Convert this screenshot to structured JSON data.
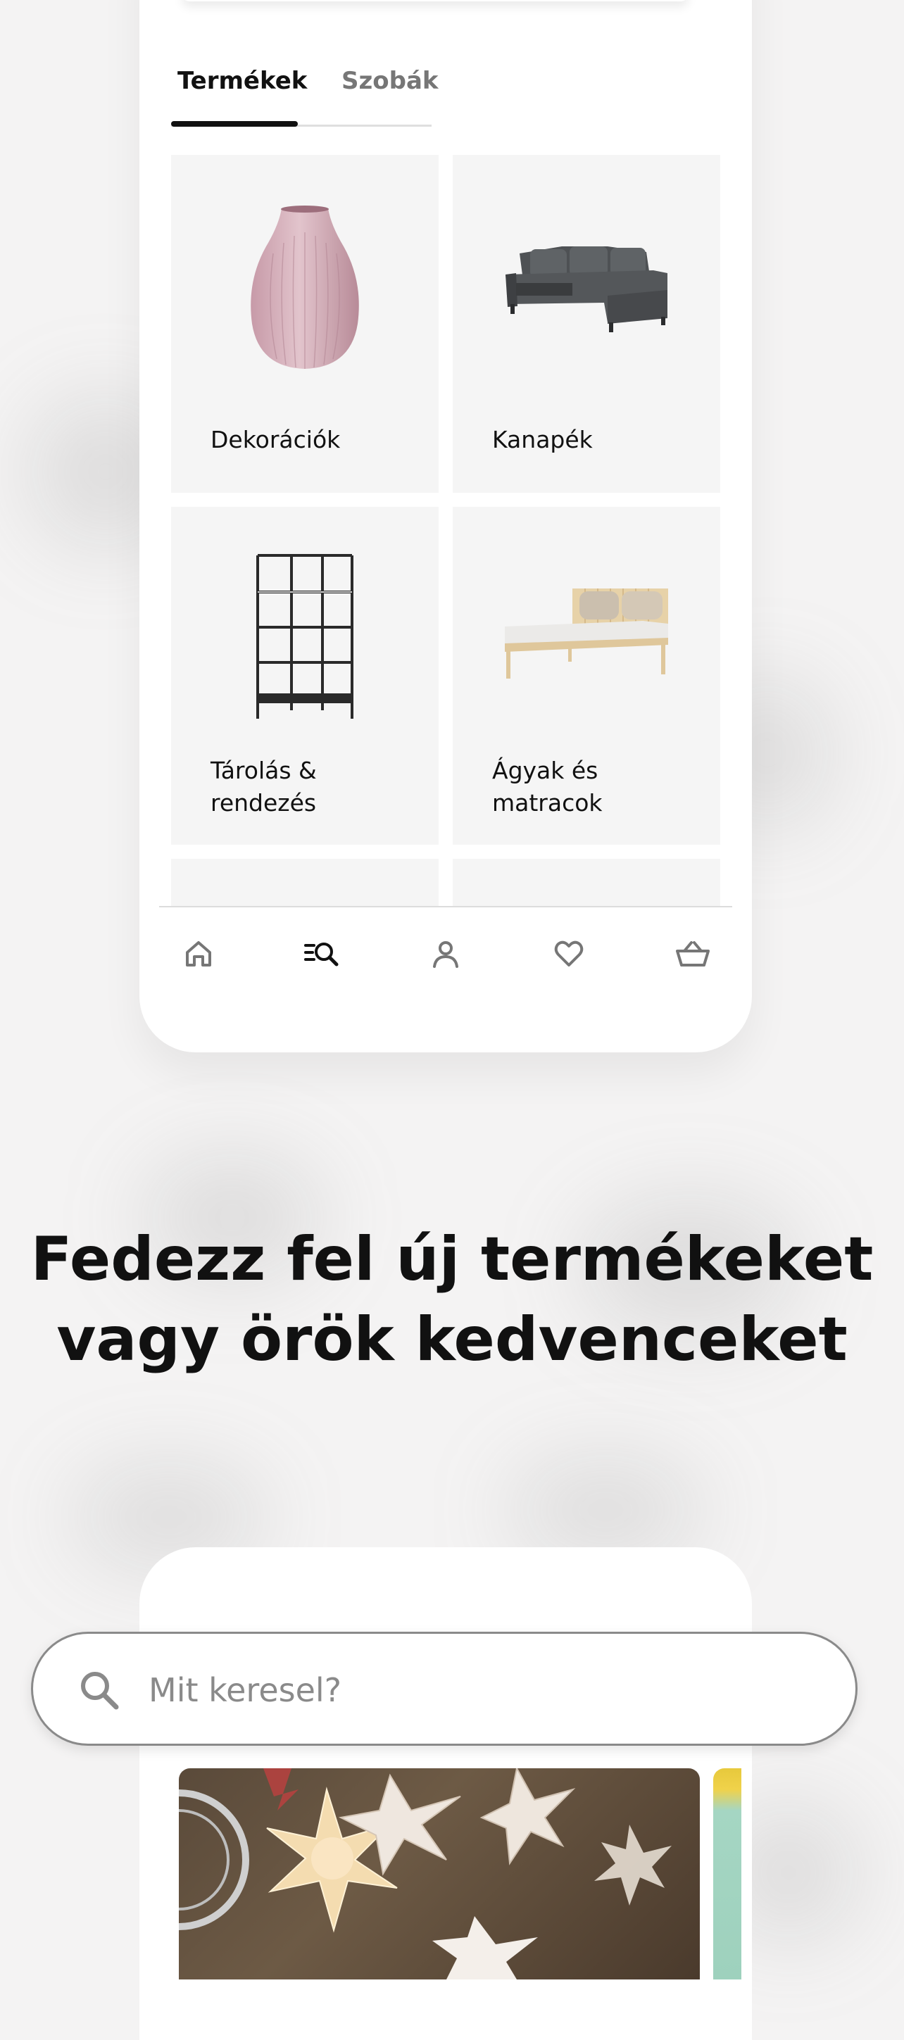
{
  "tabs": {
    "products": "Termékek",
    "rooms": "Szobák"
  },
  "categories": [
    {
      "label": "Dekorációk",
      "icon": "vase-icon"
    },
    {
      "label": "Kanapék",
      "icon": "sofa-icon"
    },
    {
      "label": "Tárolás & rendezés",
      "icon": "shelf-icon"
    },
    {
      "label": "Ágyak és matracok",
      "icon": "bed-icon"
    }
  ],
  "bottom_nav": [
    "home-icon",
    "search-list-icon",
    "profile-icon",
    "heart-icon",
    "basket-icon"
  ],
  "headline": {
    "line1": "Fedezz fel új termékeket",
    "line2": "vagy örök kedvenceket"
  },
  "search": {
    "placeholder": "Mit keresel?"
  },
  "colors": {
    "background": "#f4f3f3",
    "text": "#111111",
    "muted": "#767676",
    "card": "#f5f5f5"
  }
}
